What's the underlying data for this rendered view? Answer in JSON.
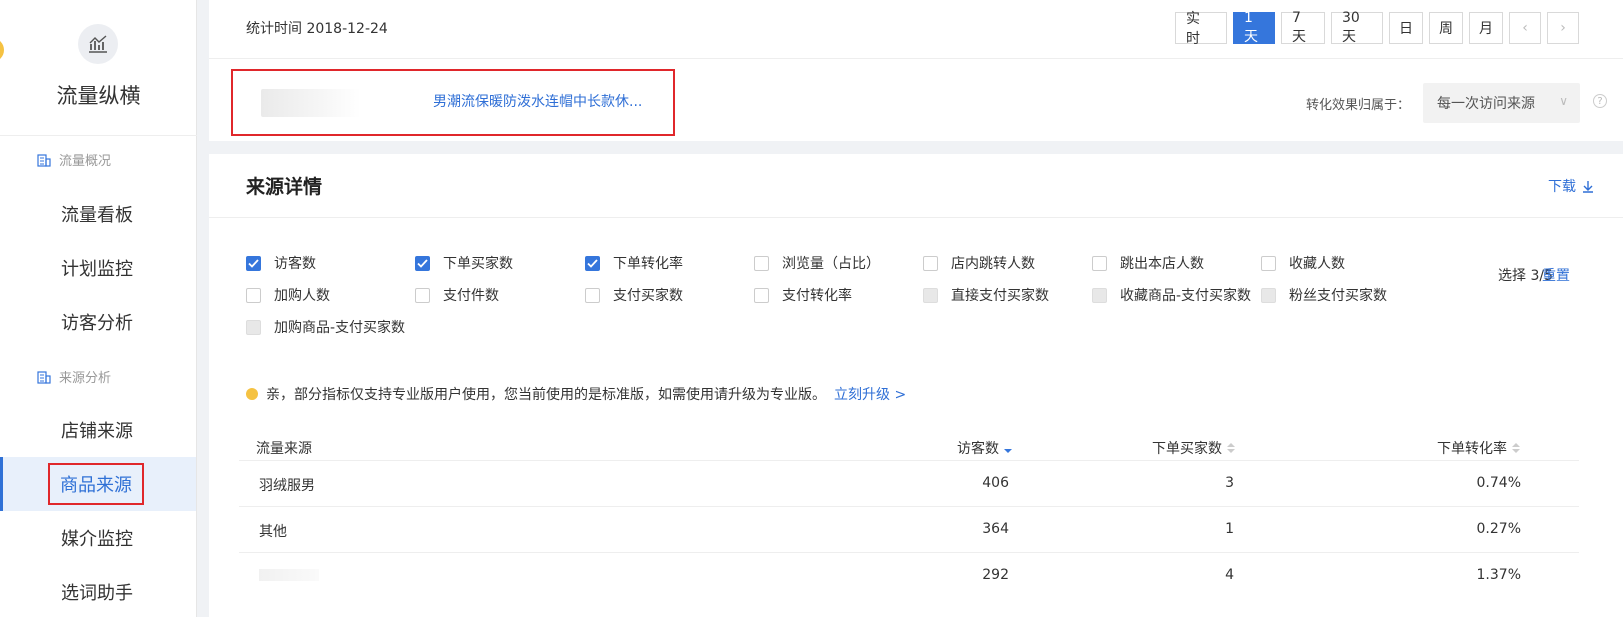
{
  "sidebar": {
    "brand_title": "流量纵横",
    "groups": [
      {
        "label": "流量概况",
        "items": [
          "流量看板",
          "计划监控",
          "访客分析"
        ]
      },
      {
        "label": "来源分析",
        "items": [
          "店铺来源",
          "商品来源",
          "媒介监控",
          "选词助手"
        ]
      }
    ],
    "active_item": "商品来源"
  },
  "top": {
    "stat_time": "统计时间 2018-12-24",
    "periods": [
      "实 时",
      "1天",
      "7天",
      "30天",
      "日",
      "周",
      "月"
    ],
    "active_period": "1天",
    "prev_arrow": "‹",
    "next_arrow": "›",
    "product_title": "男潮流保暖防泼水连帽中长款休...",
    "attribution_label": "转化效果归属于：",
    "attribution_value": "每一次访问来源",
    "help_glyph": "?"
  },
  "main": {
    "title": "来源详情",
    "download_label": "下载",
    "metrics": [
      {
        "label": "访客数",
        "state": "checked"
      },
      {
        "label": "下单买家数",
        "state": "checked"
      },
      {
        "label": "下单转化率",
        "state": "checked"
      },
      {
        "label": "浏览量（占比）",
        "state": "unchecked"
      },
      {
        "label": "店内跳转人数",
        "state": "unchecked"
      },
      {
        "label": "跳出本店人数",
        "state": "unchecked"
      },
      {
        "label": "收藏人数",
        "state": "unchecked"
      },
      {
        "label": "加购人数",
        "state": "unchecked"
      },
      {
        "label": "支付件数",
        "state": "unchecked"
      },
      {
        "label": "支付买家数",
        "state": "unchecked"
      },
      {
        "label": "支付转化率",
        "state": "unchecked"
      },
      {
        "label": "直接支付买家数",
        "state": "disabled"
      },
      {
        "label": "收藏商品-支付买家数",
        "state": "disabled"
      },
      {
        "label": "粉丝支付买家数",
        "state": "disabled"
      },
      {
        "label": "加购商品-支付买家数",
        "state": "disabled"
      }
    ],
    "select_count": "选择 3/5",
    "reset_label": "重置",
    "notice_text": "亲，部分指标仅支持专业版用户使用，您当前使用的是标准版，如需使用请升级为专业版。",
    "upgrade_label": "立刻升级 >",
    "table": {
      "headers": [
        "流量来源",
        "访客数",
        "下单买家数",
        "下单转化率"
      ],
      "rows": [
        [
          "羽绒服男",
          "406",
          "3",
          "0.74%"
        ],
        [
          "其他",
          "364",
          "1",
          "0.27%"
        ],
        [
          "",
          "292",
          "4",
          "1.37%"
        ]
      ]
    }
  },
  "colors": {
    "accent": "#3576dc",
    "highlight_border": "#e0272b",
    "warning": "#f5c242"
  }
}
